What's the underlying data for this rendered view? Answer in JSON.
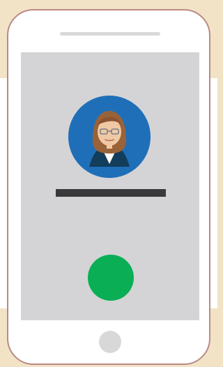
{
  "scene": {
    "icons": {
      "avatar": "woman-with-glasses-avatar-icon",
      "call": "green-call-button",
      "home": "home-button"
    },
    "colors": {
      "page_background": "#f2e3c6",
      "phone_body": "#ffffff",
      "phone_outline": "#b98a85",
      "screen": "#d4d4d6",
      "avatar_background": "#1f6fb8",
      "name_bar": "#393939",
      "call_button": "#0aae55",
      "home_button": "#d8d8d8"
    }
  }
}
